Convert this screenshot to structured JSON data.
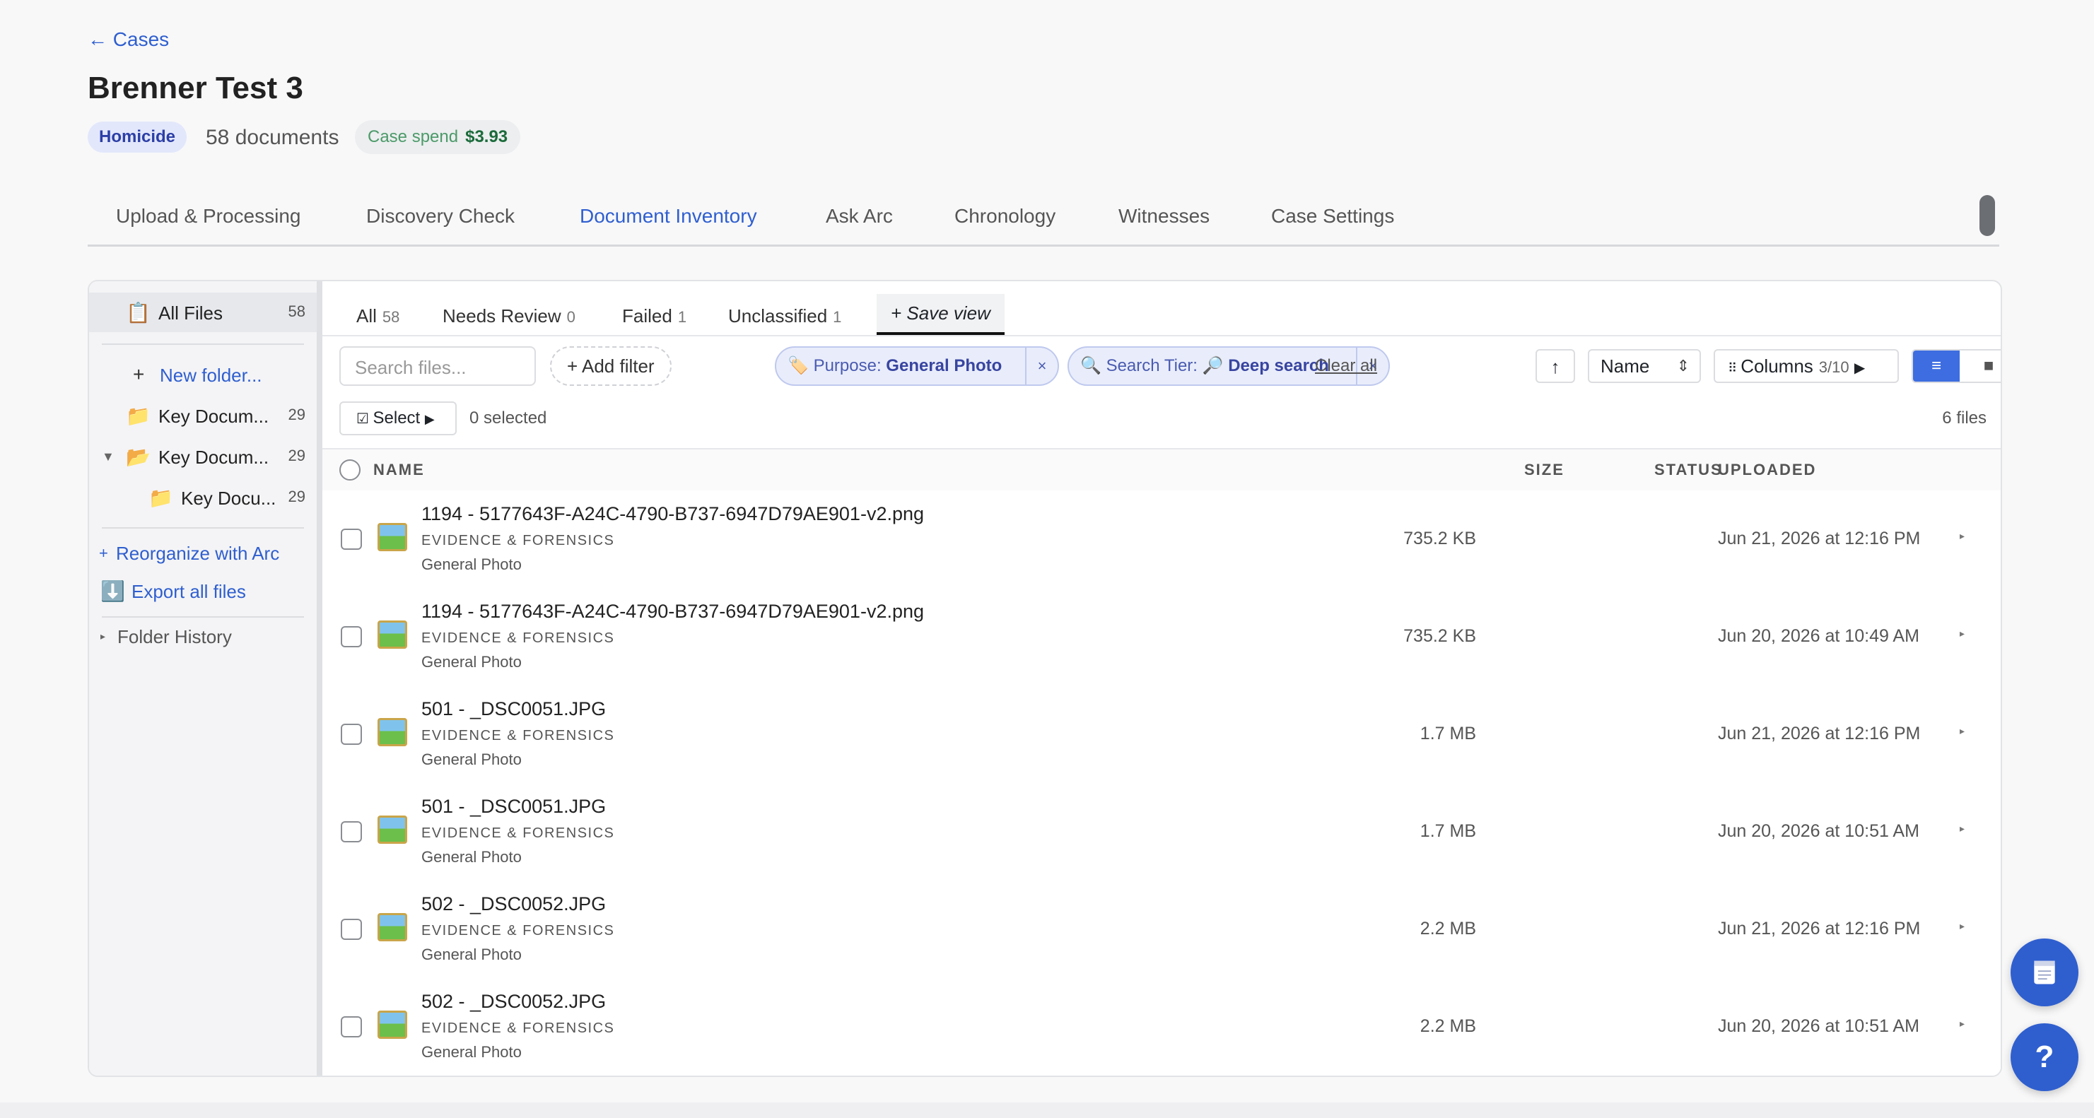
{
  "back_link": "← Cases",
  "case": {
    "title": "Brenner Test 3",
    "type_badge": "Homicide",
    "documents": "58 documents",
    "spend_label": "Case spend",
    "spend_value": "$3.93"
  },
  "tabs": [
    {
      "label": "Upload & Processing"
    },
    {
      "label": "Discovery Check"
    },
    {
      "label": "Document Inventory",
      "active": true
    },
    {
      "label": "Ask Arc"
    },
    {
      "label": "Chronology"
    },
    {
      "label": "Witnesses"
    },
    {
      "label": "Case Settings"
    }
  ],
  "sidebar": {
    "all_files": {
      "label": "All Files",
      "count": "58",
      "icon": "clipboard-icon"
    },
    "new_folder": "New folder...",
    "folders": [
      {
        "label": "Key Docum...",
        "count": "29"
      },
      {
        "label": "Key Docum...",
        "count": "29",
        "expanded": true
      },
      {
        "label": "Key Docu...",
        "count": "29"
      }
    ],
    "reorganize": "Reorganize with Arc",
    "export": "Export all files",
    "history": "Folder History"
  },
  "view_tabs": [
    {
      "label": "All",
      "count": "58"
    },
    {
      "label": "Needs Review",
      "count": "0"
    },
    {
      "label": "Failed",
      "count": "1"
    },
    {
      "label": "Unclassified",
      "count": "1"
    }
  ],
  "save_view": "+ Save view",
  "toolbar": {
    "search_placeholder": "Search files...",
    "add_filter": "Add filter",
    "filter_purpose_label": "Purpose:",
    "filter_purpose_value": "General Photo",
    "filter_tier_label": "Search Tier:",
    "filter_tier_value": "Deep search",
    "clear_all": "Clear all",
    "sort_value": "Name",
    "columns_label": "Columns",
    "columns_count": "3/10",
    "select_label": "Select",
    "selected_count": "0 selected",
    "files_count": "6 files"
  },
  "table": {
    "headers": {
      "name": "NAME",
      "size": "SIZE",
      "status": "STATUS",
      "uploaded": "UPLOADED"
    },
    "rows": [
      {
        "name": "1194 - 5177643F-A24C-4790-B737-6947D79AE901-v2.png",
        "category": "EVIDENCE & FORENSICS",
        "purpose": "General Photo",
        "size": "735.2 KB",
        "uploaded": "Jun 21, 2026 at 12:16 PM"
      },
      {
        "name": "1194 - 5177643F-A24C-4790-B737-6947D79AE901-v2.png",
        "category": "EVIDENCE & FORENSICS",
        "purpose": "General Photo",
        "size": "735.2 KB",
        "uploaded": "Jun 20, 2026 at 10:49 AM"
      },
      {
        "name": "501 - _DSC0051.JPG",
        "category": "EVIDENCE & FORENSICS",
        "purpose": "General Photo",
        "size": "1.7 MB",
        "uploaded": "Jun 21, 2026 at 12:16 PM"
      },
      {
        "name": "501 - _DSC0051.JPG",
        "category": "EVIDENCE & FORENSICS",
        "purpose": "General Photo",
        "size": "1.7 MB",
        "uploaded": "Jun 20, 2026 at 10:51 AM"
      },
      {
        "name": "502 - _DSC0052.JPG",
        "category": "EVIDENCE & FORENSICS",
        "purpose": "General Photo",
        "size": "2.2 MB",
        "uploaded": "Jun 21, 2026 at 12:16 PM"
      },
      {
        "name": "502 - _DSC0052.JPG",
        "category": "EVIDENCE & FORENSICS",
        "purpose": "General Photo",
        "size": "2.2 MB",
        "uploaded": "Jun 20, 2026 at 10:51 AM"
      }
    ]
  },
  "fab_help": "?",
  "colors": {
    "accent": "#2f5fcf",
    "badge_bg": "#e2e7fb",
    "spend_green": "#1c6b3b",
    "view_active": "#3d6de0"
  }
}
